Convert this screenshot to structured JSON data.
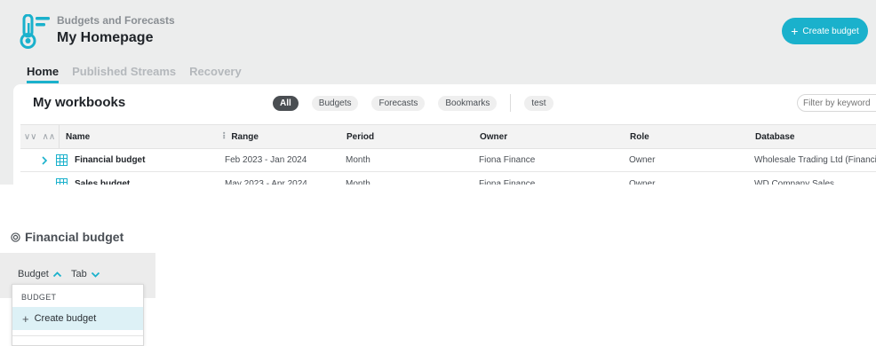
{
  "header": {
    "app_subtitle": "Budgets and Forecasts",
    "title": "My Homepage",
    "create_button": "Create budget"
  },
  "nav": {
    "tabs": [
      {
        "label": "Home",
        "active": true
      },
      {
        "label": "Published Streams",
        "active": false
      },
      {
        "label": "Recovery",
        "active": false
      }
    ]
  },
  "workbooks": {
    "title": "My workbooks",
    "filters": [
      "All",
      "Budgets",
      "Forecasts",
      "Bookmarks",
      "test"
    ],
    "search_placeholder": "Filter by keyword",
    "columns": [
      "Name",
      "Range",
      "Period",
      "Owner",
      "Role",
      "Database"
    ],
    "rows": [
      {
        "name": "Financial budget",
        "range": "Feb 2023 - Jan 2024",
        "period": "Month",
        "owner": "Fiona Finance",
        "role": "Owner",
        "database": "Wholesale Trading Ltd (Financials"
      },
      {
        "name": "Sales budget",
        "range": "May 2023 - Apr 2024",
        "period": "Month",
        "owner": "Fiona Finance",
        "role": "Owner",
        "database": "WD Company Sales"
      }
    ]
  },
  "budget_panel": {
    "title": "Financial budget",
    "toolbar": {
      "budget_label": "Budget",
      "tab_label": "Tab"
    },
    "dropdown": {
      "header": "BUDGET",
      "item": "Create budget"
    }
  },
  "colors": {
    "accent": "#1ab1cc",
    "header_bg": "#eceded",
    "selected_item_bg": "#ddf1f6"
  },
  "icons": {
    "logo": "thermometer-logo-icon",
    "expand": "chevron-right-icon",
    "workbook": "grid-icon",
    "title": "target-icon"
  }
}
